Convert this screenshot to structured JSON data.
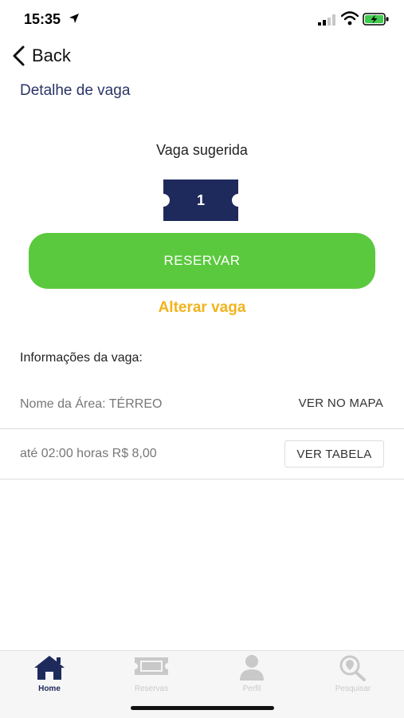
{
  "status_bar": {
    "time": "15:35"
  },
  "nav": {
    "back_label": "Back"
  },
  "page": {
    "title": "Detalhe de vaga"
  },
  "suggestion": {
    "label": "Vaga sugerida",
    "spot_number": "1"
  },
  "actions": {
    "reserve_label": "RESERVAR",
    "change_label": "Alterar vaga"
  },
  "info": {
    "heading": "Informações da vaga:",
    "area_text": "Nome da Área: TÉRREO",
    "map_link": "VER NO MAPA",
    "price_text": "até 02:00 horas R$ 8,00",
    "table_button": "VER TABELA"
  },
  "tabs": [
    {
      "label": "Home",
      "icon": "home-icon",
      "active": true
    },
    {
      "label": "Reservas",
      "icon": "ticket-icon",
      "active": false
    },
    {
      "label": "Perfil",
      "icon": "person-icon",
      "active": false
    },
    {
      "label": "Pesquisar",
      "icon": "search-location-icon",
      "active": false
    }
  ],
  "colors": {
    "primary": "#1f2a5c",
    "reserve_green": "#5ac93e",
    "change_link": "#f2b31c",
    "title": "#2a3566"
  }
}
